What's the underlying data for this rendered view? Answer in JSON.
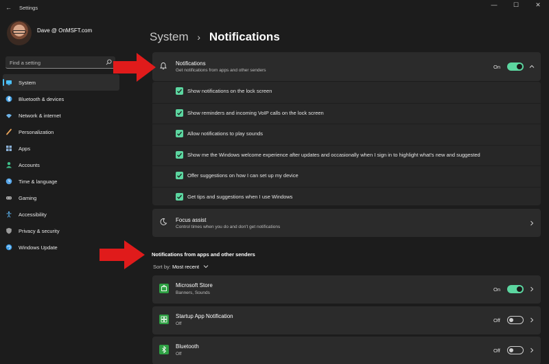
{
  "window": {
    "title": "Settings",
    "back_glyph": "←",
    "controls": {
      "minimize": "—",
      "maximize": "☐",
      "close": "✕"
    }
  },
  "profile": {
    "name": "Dave @ OnMSFT.com"
  },
  "search": {
    "placeholder": "Find a setting"
  },
  "sidebar": {
    "items": [
      {
        "label": "System",
        "icon": "system-icon",
        "color": "#4cc2ff",
        "active": true
      },
      {
        "label": "Bluetooth & devices",
        "icon": "bluetooth-icon",
        "color": "#3b9be0"
      },
      {
        "label": "Network & internet",
        "icon": "wifi-icon",
        "color": "#6fb4e8"
      },
      {
        "label": "Personalization",
        "icon": "brush-icon",
        "color": "#e8a35a"
      },
      {
        "label": "Apps",
        "icon": "apps-icon",
        "color": "#8ab0d6"
      },
      {
        "label": "Accounts",
        "icon": "person-icon",
        "color": "#3fc08a"
      },
      {
        "label": "Time & language",
        "icon": "globe-clock-icon",
        "color": "#58a6e8"
      },
      {
        "label": "Gaming",
        "icon": "controller-icon",
        "color": "#b0b0b0"
      },
      {
        "label": "Accessibility",
        "icon": "accessibility-icon",
        "color": "#5aaee8"
      },
      {
        "label": "Privacy & security",
        "icon": "shield-icon",
        "color": "#9a9a9a"
      },
      {
        "label": "Windows Update",
        "icon": "update-icon",
        "color": "#3e9ee8"
      }
    ]
  },
  "breadcrumb": {
    "parent": "System",
    "separator": "›",
    "current": "Notifications"
  },
  "notifications_card": {
    "title": "Notifications",
    "subtitle": "Get notifications from apps and other senders",
    "toggle_label": "On",
    "toggle_on": true,
    "options": [
      "Show notifications on the lock screen",
      "Show reminders and incoming VoIP calls on the lock screen",
      "Allow notifications to play sounds",
      "Show me the Windows welcome experience after updates and occasionally when I sign in to highlight what's new and suggested",
      "Offer suggestions on how I can set up my device",
      "Get tips and suggestions when I use Windows"
    ]
  },
  "focus_assist": {
    "title": "Focus assist",
    "subtitle": "Control times when you do and don't get notifications"
  },
  "apps_section": {
    "title": "Notifications from apps and other senders",
    "sort_label": "Sort by:",
    "sort_value": "Most recent",
    "apps": [
      {
        "name": "Microsoft Store",
        "detail": "Banners, Sounds",
        "state": "On",
        "on": true,
        "icon": "store-icon",
        "color": "#2ea043"
      },
      {
        "name": "Startup App Notification",
        "detail": "Off",
        "state": "Off",
        "on": false,
        "icon": "startup-app-icon",
        "color": "#2ea043"
      },
      {
        "name": "Bluetooth",
        "detail": "Off",
        "state": "Off",
        "on": false,
        "icon": "bluetooth-icon",
        "color": "#2ea043"
      }
    ]
  },
  "colors": {
    "accent": "#5cd6a0",
    "highlight": "#4cc2ff",
    "annotation_arrow": "#e01b1b"
  }
}
